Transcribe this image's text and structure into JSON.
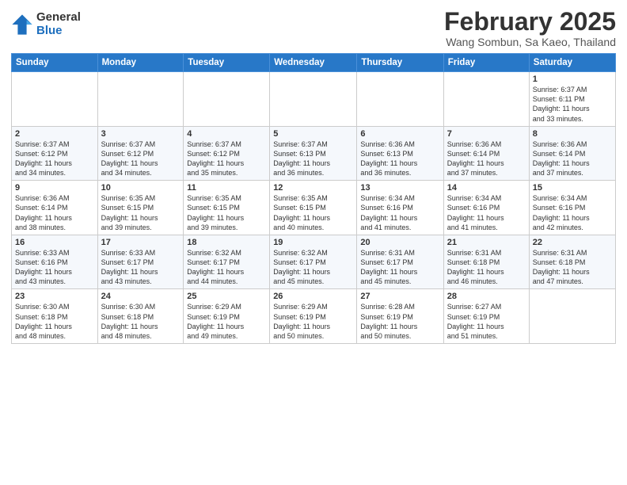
{
  "header": {
    "logo": {
      "general": "General",
      "blue": "Blue"
    },
    "month": "February 2025",
    "location": "Wang Sombun, Sa Kaeo, Thailand"
  },
  "days_of_week": [
    "Sunday",
    "Monday",
    "Tuesday",
    "Wednesday",
    "Thursday",
    "Friday",
    "Saturday"
  ],
  "weeks": [
    [
      {
        "day": "",
        "info": ""
      },
      {
        "day": "",
        "info": ""
      },
      {
        "day": "",
        "info": ""
      },
      {
        "day": "",
        "info": ""
      },
      {
        "day": "",
        "info": ""
      },
      {
        "day": "",
        "info": ""
      },
      {
        "day": "1",
        "info": "Sunrise: 6:37 AM\nSunset: 6:11 PM\nDaylight: 11 hours\nand 33 minutes."
      }
    ],
    [
      {
        "day": "2",
        "info": "Sunrise: 6:37 AM\nSunset: 6:12 PM\nDaylight: 11 hours\nand 34 minutes."
      },
      {
        "day": "3",
        "info": "Sunrise: 6:37 AM\nSunset: 6:12 PM\nDaylight: 11 hours\nand 34 minutes."
      },
      {
        "day": "4",
        "info": "Sunrise: 6:37 AM\nSunset: 6:12 PM\nDaylight: 11 hours\nand 35 minutes."
      },
      {
        "day": "5",
        "info": "Sunrise: 6:37 AM\nSunset: 6:13 PM\nDaylight: 11 hours\nand 36 minutes."
      },
      {
        "day": "6",
        "info": "Sunrise: 6:36 AM\nSunset: 6:13 PM\nDaylight: 11 hours\nand 36 minutes."
      },
      {
        "day": "7",
        "info": "Sunrise: 6:36 AM\nSunset: 6:14 PM\nDaylight: 11 hours\nand 37 minutes."
      },
      {
        "day": "8",
        "info": "Sunrise: 6:36 AM\nSunset: 6:14 PM\nDaylight: 11 hours\nand 37 minutes."
      }
    ],
    [
      {
        "day": "9",
        "info": "Sunrise: 6:36 AM\nSunset: 6:14 PM\nDaylight: 11 hours\nand 38 minutes."
      },
      {
        "day": "10",
        "info": "Sunrise: 6:35 AM\nSunset: 6:15 PM\nDaylight: 11 hours\nand 39 minutes."
      },
      {
        "day": "11",
        "info": "Sunrise: 6:35 AM\nSunset: 6:15 PM\nDaylight: 11 hours\nand 39 minutes."
      },
      {
        "day": "12",
        "info": "Sunrise: 6:35 AM\nSunset: 6:15 PM\nDaylight: 11 hours\nand 40 minutes."
      },
      {
        "day": "13",
        "info": "Sunrise: 6:34 AM\nSunset: 6:16 PM\nDaylight: 11 hours\nand 41 minutes."
      },
      {
        "day": "14",
        "info": "Sunrise: 6:34 AM\nSunset: 6:16 PM\nDaylight: 11 hours\nand 41 minutes."
      },
      {
        "day": "15",
        "info": "Sunrise: 6:34 AM\nSunset: 6:16 PM\nDaylight: 11 hours\nand 42 minutes."
      }
    ],
    [
      {
        "day": "16",
        "info": "Sunrise: 6:33 AM\nSunset: 6:16 PM\nDaylight: 11 hours\nand 43 minutes."
      },
      {
        "day": "17",
        "info": "Sunrise: 6:33 AM\nSunset: 6:17 PM\nDaylight: 11 hours\nand 43 minutes."
      },
      {
        "day": "18",
        "info": "Sunrise: 6:32 AM\nSunset: 6:17 PM\nDaylight: 11 hours\nand 44 minutes."
      },
      {
        "day": "19",
        "info": "Sunrise: 6:32 AM\nSunset: 6:17 PM\nDaylight: 11 hours\nand 45 minutes."
      },
      {
        "day": "20",
        "info": "Sunrise: 6:31 AM\nSunset: 6:17 PM\nDaylight: 11 hours\nand 45 minutes."
      },
      {
        "day": "21",
        "info": "Sunrise: 6:31 AM\nSunset: 6:18 PM\nDaylight: 11 hours\nand 46 minutes."
      },
      {
        "day": "22",
        "info": "Sunrise: 6:31 AM\nSunset: 6:18 PM\nDaylight: 11 hours\nand 47 minutes."
      }
    ],
    [
      {
        "day": "23",
        "info": "Sunrise: 6:30 AM\nSunset: 6:18 PM\nDaylight: 11 hours\nand 48 minutes."
      },
      {
        "day": "24",
        "info": "Sunrise: 6:30 AM\nSunset: 6:18 PM\nDaylight: 11 hours\nand 48 minutes."
      },
      {
        "day": "25",
        "info": "Sunrise: 6:29 AM\nSunset: 6:19 PM\nDaylight: 11 hours\nand 49 minutes."
      },
      {
        "day": "26",
        "info": "Sunrise: 6:29 AM\nSunset: 6:19 PM\nDaylight: 11 hours\nand 50 minutes."
      },
      {
        "day": "27",
        "info": "Sunrise: 6:28 AM\nSunset: 6:19 PM\nDaylight: 11 hours\nand 50 minutes."
      },
      {
        "day": "28",
        "info": "Sunrise: 6:27 AM\nSunset: 6:19 PM\nDaylight: 11 hours\nand 51 minutes."
      },
      {
        "day": "",
        "info": ""
      }
    ]
  ]
}
